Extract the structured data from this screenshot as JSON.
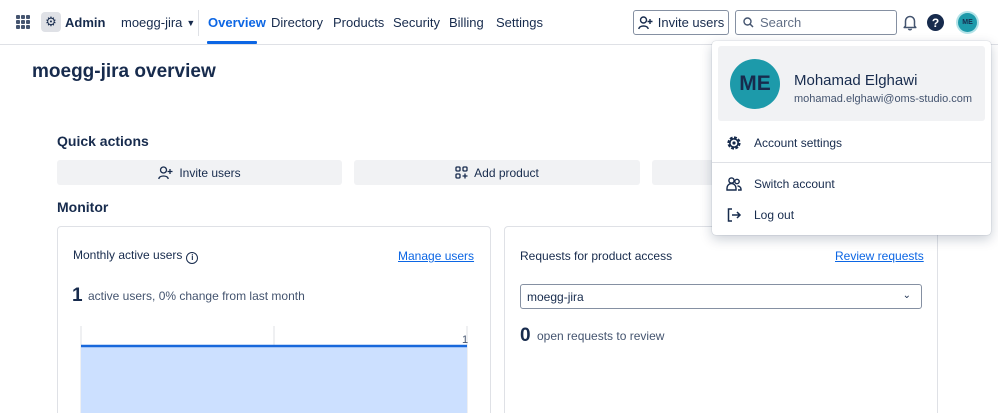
{
  "topnav": {
    "app_name": "Admin",
    "org_name": "moegg-jira",
    "tabs": [
      {
        "label": "Overview",
        "active": true
      },
      {
        "label": "Directory",
        "active": false
      },
      {
        "label": "Products",
        "active": false
      },
      {
        "label": "Security",
        "active": false
      },
      {
        "label": "Billing",
        "active": false
      },
      {
        "label": "Settings",
        "active": false
      }
    ],
    "invite_label": "Invite users",
    "search_placeholder": "Search",
    "avatar_initials": "ME"
  },
  "main": {
    "title": "moegg-jira overview",
    "quick_actions": {
      "title": "Quick actions",
      "buttons": [
        {
          "label": "Invite users",
          "icon": "person-add-icon"
        },
        {
          "label": "Add product",
          "icon": "apps-add-icon"
        }
      ]
    },
    "monitor": {
      "title": "Monitor",
      "active_users_card": {
        "title": "Monthly active users",
        "link": "Manage users",
        "count": "1",
        "description": "active users, 0% change from last month"
      },
      "requests_card": {
        "title": "Requests for product access",
        "link": "Review requests",
        "select_value": "moegg-jira",
        "count": "0",
        "description": "open requests to review"
      }
    }
  },
  "chart_data": {
    "type": "area",
    "series": [
      {
        "values": [
          1,
          1,
          1
        ]
      }
    ],
    "data_labels": [
      "1"
    ],
    "grid": true
  },
  "profile_menu": {
    "initials": "ME",
    "name": "Mohamad Elghawi",
    "email": "mohamad.elghawi@oms-studio.com",
    "items": [
      {
        "label": "Account settings",
        "icon": "gear-icon"
      },
      {
        "label": "Switch account",
        "icon": "switch-account-icon"
      },
      {
        "label": "Log out",
        "icon": "log-out-icon"
      }
    ]
  },
  "colors": {
    "accent": "#0c66e4",
    "avatar": "#1d9aaa",
    "chart_fill": "#cce0ff",
    "chart_line": "#1868db"
  }
}
